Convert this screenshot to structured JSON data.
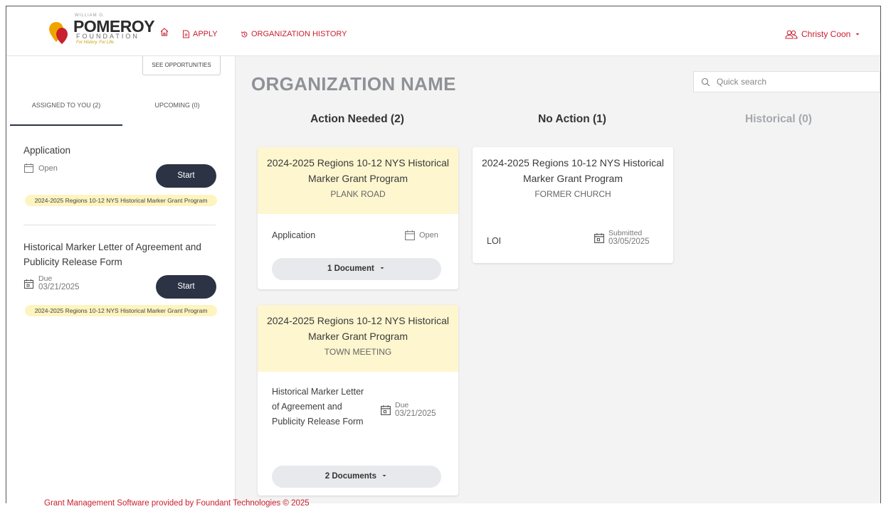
{
  "header": {
    "logo": {
      "small_text": "WILLIAM G.",
      "brand": "POMEROY",
      "foundation": "FOUNDATION",
      "tagline": "For History. For Life."
    },
    "nav": {
      "apply": "APPLY",
      "org_history": "ORGANIZATION HISTORY"
    },
    "user": {
      "name": "Christy Coon"
    }
  },
  "sidebar": {
    "see_opportunities": "SEE OPPORTUNITIES",
    "tabs": [
      {
        "label": "ASSIGNED TO YOU (2)",
        "active": true
      },
      {
        "label": "UPCOMING (0)",
        "active": false
      }
    ],
    "tasks": [
      {
        "title": "Application",
        "status": "Open",
        "action": "Start",
        "program": "2024-2025 Regions 10-12 NYS Historical Marker Grant Program"
      },
      {
        "title": "Historical Marker Letter of Agreement and Publicity Release Form",
        "status_label": "Due",
        "status_date": "03/21/2025",
        "action": "Start",
        "program": "2024-2025 Regions 10-12 NYS Historical Marker Grant Program"
      }
    ]
  },
  "main": {
    "org_name": "ORGANIZATION NAME",
    "search": {
      "placeholder": "Quick search",
      "value": ""
    },
    "columns": [
      {
        "title": "Action Needed (2)"
      },
      {
        "title": "No Action (1)"
      },
      {
        "title": "Historical (0)"
      }
    ],
    "cards": {
      "plank_road": {
        "title": "2024-2025 Regions 10-12 NYS Historical Marker Grant Program",
        "subtitle": "PLANK ROAD",
        "item_label": "Application",
        "item_status": "Open",
        "documents": "1 Document"
      },
      "town_meeting": {
        "title": "2024-2025 Regions 10-12 NYS Historical Marker Grant Program",
        "subtitle": "TOWN MEETING",
        "item_label": "Historical Marker Letter of Agreement and Publicity Release Form",
        "item_status_label": "Due",
        "item_status_date": "03/21/2025",
        "documents": "2 Documents"
      },
      "former_church": {
        "title": "2024-2025 Regions 10-12 NYS Historical Marker Grant Program",
        "subtitle": "FORMER CHURCH",
        "item_label": "LOI",
        "item_status_label": "Submitted",
        "item_status_date": "03/05/2025"
      }
    }
  },
  "footer": {
    "text": "Grant Management Software provided by Foundant Technologies © 2025"
  },
  "colors": {
    "accent": "#c8202f",
    "dark_button": "#2b3345",
    "highlight": "#fdf6cf",
    "badge": "#fdf4c0"
  }
}
